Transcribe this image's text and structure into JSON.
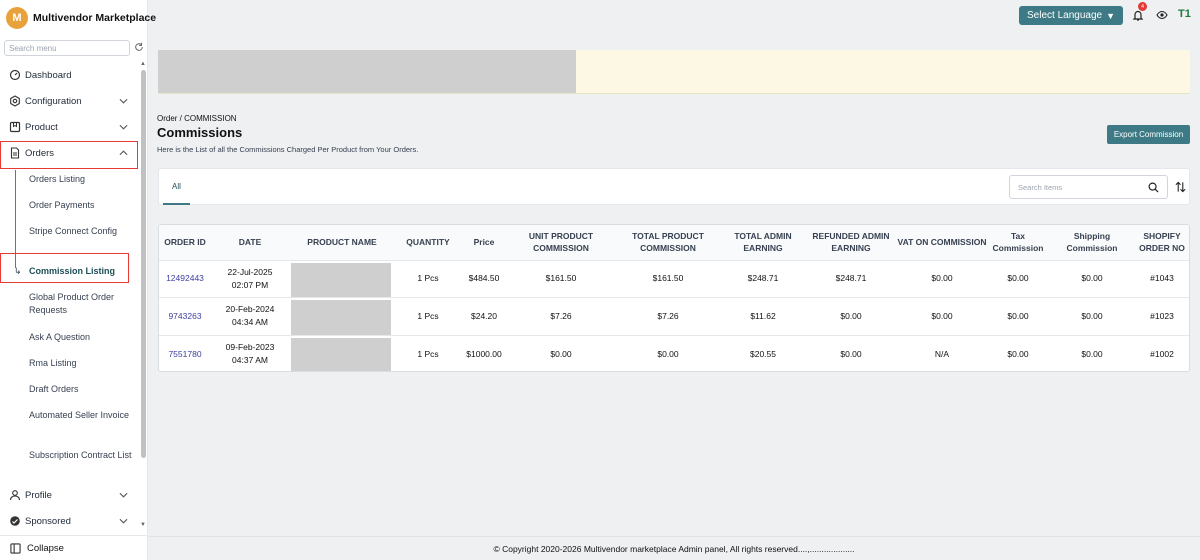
{
  "brand": {
    "initial": "M",
    "name": "Multivendor Marketplace"
  },
  "sidebar": {
    "search_placeholder": "Search menu",
    "items": [
      {
        "label": "Dashboard",
        "icon": "dashboard-icon"
      },
      {
        "label": "Configuration",
        "icon": "gear-icon"
      },
      {
        "label": "Product",
        "icon": "product-icon"
      },
      {
        "label": "Orders",
        "icon": "orders-icon"
      },
      {
        "label": "Profile",
        "icon": "user-icon"
      },
      {
        "label": "Sponsored",
        "icon": "sponsored-icon"
      }
    ],
    "orders_sub": [
      "Orders Listing",
      "Order Payments",
      "Stripe Connect Config",
      "Commission Listing",
      "Global Product Order Requests",
      "Ask A Question",
      "Rma Listing",
      "Draft Orders",
      "Automated Seller Invoice",
      "Subscription Contract List"
    ],
    "collapse_label": "Collapse"
  },
  "topbar": {
    "language_label": "Select Language",
    "notification_count": "4",
    "user_initials": "T1"
  },
  "page": {
    "breadcrumb": "Order / COMMISSION",
    "title": "Commissions",
    "description": "Here is the List of all the Commissions Charged Per Product from Your Orders.",
    "export_label": "Export Commission",
    "tab_all": "All",
    "search_placeholder": "Search Items"
  },
  "table": {
    "headers": [
      "ORDER ID",
      "DATE",
      "PRODUCT NAME",
      "QUANTITY",
      "Price",
      "UNIT PRODUCT COMMISSION",
      "TOTAL PRODUCT COMMISSION",
      "TOTAL ADMIN EARNING",
      "REFUNDED ADMIN EARNING",
      "VAT ON COMMISSION",
      "Tax Commission",
      "Shipping Commission",
      "SHOPIFY ORDER NO"
    ],
    "rows": [
      {
        "order_id": "12492443",
        "date": "22-Jul-2025",
        "time": "02:07 PM",
        "quantity": "1 Pcs",
        "price": "$484.50",
        "unit_commission": "$161.50",
        "total_commission": "$161.50",
        "admin_earning": "$248.71",
        "refunded": "$248.71",
        "vat": "$0.00",
        "tax": "$0.00",
        "shipping": "$0.00",
        "shopify": "#1043"
      },
      {
        "order_id": "9743263",
        "date": "20-Feb-2024",
        "time": "04:34 AM",
        "quantity": "1 Pcs",
        "price": "$24.20",
        "unit_commission": "$7.26",
        "total_commission": "$7.26",
        "admin_earning": "$11.62",
        "refunded": "$0.00",
        "vat": "$0.00",
        "tax": "$0.00",
        "shipping": "$0.00",
        "shopify": "#1023"
      },
      {
        "order_id": "7551780",
        "date": "09-Feb-2023",
        "time": "04:37 AM",
        "quantity": "1 Pcs",
        "price": "$1000.00",
        "unit_commission": "$0.00",
        "total_commission": "$0.00",
        "admin_earning": "$20.55",
        "refunded": "$0.00",
        "vat": "N/A",
        "tax": "$0.00",
        "shipping": "$0.00",
        "shopify": "#1002"
      }
    ]
  },
  "footer": {
    "text": "© Copyright 2020-2026 Multivendor marketplace Admin panel, All rights reserved....,..................."
  },
  "colors": {
    "accent": "#3d7a85",
    "highlight_border": "#e53935",
    "brand_logo": "#e9a23b",
    "banner": "#fdf8e4"
  }
}
